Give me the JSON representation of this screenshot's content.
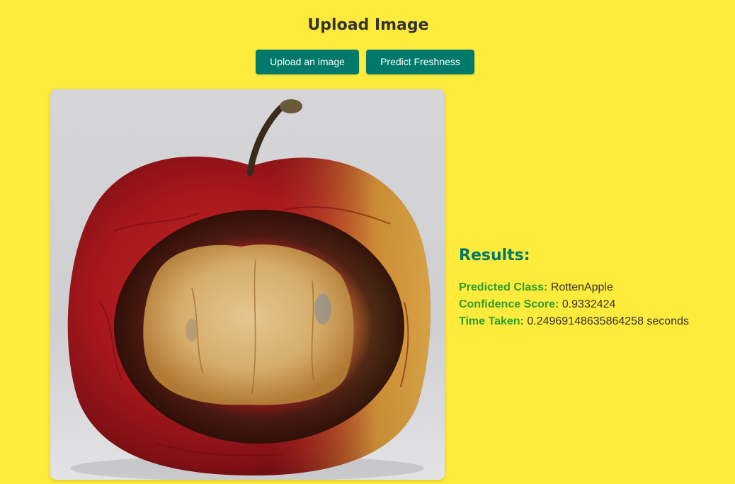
{
  "header": {
    "title": "Upload Image"
  },
  "actions": {
    "upload_label": "Upload an image",
    "predict_label": "Predict Freshness"
  },
  "preview": {
    "subject": "rotten apple photo"
  },
  "results": {
    "heading": "Results:",
    "predicted_class_label": "Predicted Class:",
    "predicted_class_value": "RottenApple",
    "confidence_label": "Confidence Score:",
    "confidence_value": "0.9332424",
    "time_label": "Time Taken:",
    "time_value": "0.24969148635864258 seconds"
  },
  "colors": {
    "background": "#ffeb3b",
    "button": "#00796b",
    "heading_accent": "#00796b",
    "label_accent": "#2e9e2e"
  }
}
